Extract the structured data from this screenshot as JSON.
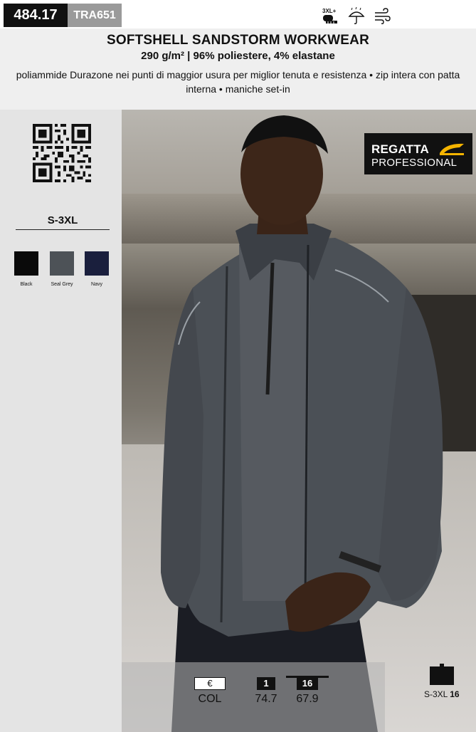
{
  "product": {
    "code": "484.17",
    "supplier_code": "TRA651",
    "title": "SOFTSHELL SANDSTORM WORKWEAR",
    "subtitle": "290 g/m² | 96% poliestere, 4% elastane",
    "description": "poliammide Durazone nei punti di maggior usura per miglior tenuta e resistenza • zip intera con patta interna • maniche set-in"
  },
  "icons": {
    "size_badge_text": "3XL+",
    "items": [
      "size-plus-icon",
      "waterproof-umbrella-icon",
      "windproof-icon"
    ]
  },
  "sizes": {
    "range": "S-3XL"
  },
  "colors": [
    {
      "name": "Black",
      "hex": "#0a0a0a"
    },
    {
      "name": "Seal Grey",
      "hex": "#4d5257"
    },
    {
      "name": "Navy",
      "hex": "#1a1f3d"
    }
  ],
  "brand": {
    "line1": "REGATTA",
    "line2": "PROFESSIONAL",
    "accent": "#f5b400"
  },
  "pricing": {
    "currency_symbol": "€",
    "col_label": "COL",
    "tiers": [
      {
        "qty": "1",
        "price": "74.7"
      },
      {
        "qty": "16",
        "price": "67.9"
      }
    ]
  },
  "packaging": {
    "sizes": "S-3XL",
    "qty": "16"
  }
}
